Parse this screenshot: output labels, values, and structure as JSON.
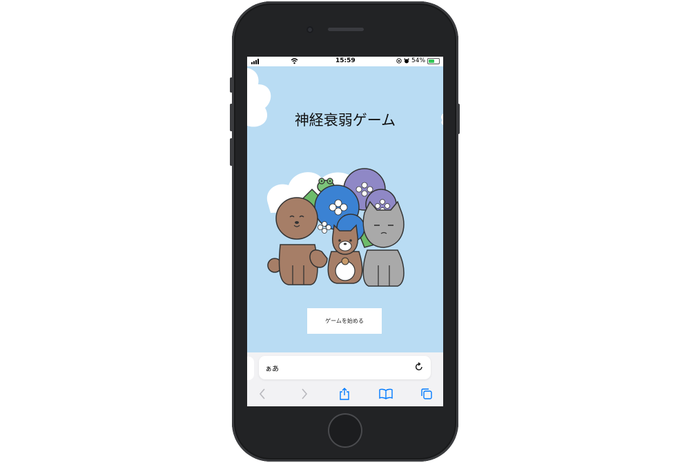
{
  "status_bar": {
    "time": "15:59",
    "battery_percent": "54%",
    "icons": [
      "cellular-signal-icon",
      "wifi-icon",
      "lock-rotation-icon",
      "alarm-icon",
      "battery-charging-icon"
    ]
  },
  "page": {
    "title": "神経衰弱ゲーム",
    "start_button_label": "ゲームを始める",
    "background_color": "#b9dcf3",
    "illustration_icon": "animals-with-hydrangeas-illustration"
  },
  "browser": {
    "address_text": "ぁあ",
    "toolbar_icons": [
      "back-icon",
      "forward-icon",
      "share-icon",
      "bookmarks-icon",
      "tabs-icon"
    ],
    "accent_color": "#007aff"
  }
}
